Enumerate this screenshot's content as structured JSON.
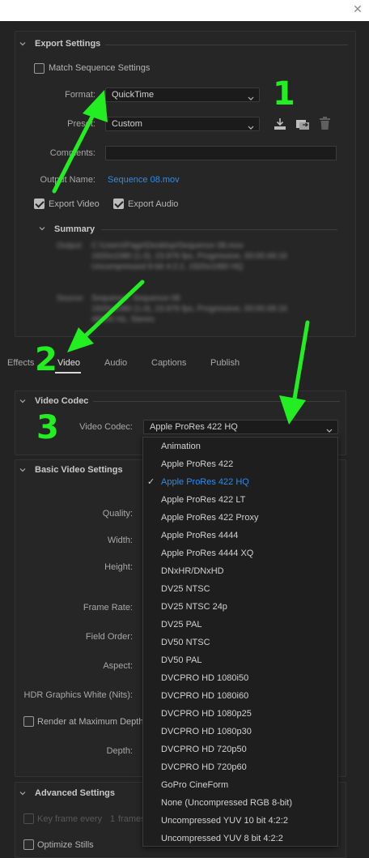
{
  "dialog": {
    "close_glyph": "✕"
  },
  "export_settings": {
    "title": "Export Settings",
    "match_sequence": {
      "label": "Match Sequence Settings",
      "checked": false
    },
    "format": {
      "label": "Format:",
      "value": "QuickTime"
    },
    "preset": {
      "label": "Preset:",
      "value": "Custom"
    },
    "comments": {
      "label": "Comments:",
      "value": ""
    },
    "output_name": {
      "label": "Output Name:",
      "value": "Sequence 08.mov"
    },
    "export_video": {
      "label": "Export Video",
      "checked": true
    },
    "export_audio": {
      "label": "Export Audio",
      "checked": true
    },
    "preset_icons": [
      "save-preset-icon",
      "import-preset-icon",
      "delete-preset-icon"
    ]
  },
  "summary": {
    "title": "Summary",
    "output_label": "Output:",
    "output_lines": [
      "C:\\Users\\Page\\Desktop\\Sequence 08.mov",
      "1920x1080 (1.0), 23.976 fps, Progressive, 00:00:49:16",
      "Uncompressed 8-bit 4:2:2, 1920x1080 HQ"
    ],
    "source_label": "Source:",
    "source_lines": [
      "Sequence, Sequence 08",
      "1920x1080 (1.0), 23.976 fps, Progressive, 00:00:49:16",
      "48000 Hz, Stereo"
    ]
  },
  "tabs": [
    {
      "label": "Effects",
      "active": false
    },
    {
      "label": "Video",
      "active": true
    },
    {
      "label": "Audio",
      "active": false
    },
    {
      "label": "Captions",
      "active": false
    },
    {
      "label": "Publish",
      "active": false
    }
  ],
  "video_codec": {
    "title": "Video Codec",
    "label": "Video Codec:",
    "value": "Apple ProRes 422 HQ",
    "options": [
      "Animation",
      "Apple ProRes 422",
      "Apple ProRes 422 HQ",
      "Apple ProRes 422 LT",
      "Apple ProRes 422 Proxy",
      "Apple ProRes 4444",
      "Apple ProRes 4444 XQ",
      "DNxHR/DNxHD",
      "DV25 NTSC",
      "DV25 NTSC 24p",
      "DV25 PAL",
      "DV50 NTSC",
      "DV50 PAL",
      "DVCPRO HD 1080i50",
      "DVCPRO HD 1080i60",
      "DVCPRO HD 1080p25",
      "DVCPRO HD 1080p30",
      "DVCPRO HD 720p50",
      "DVCPRO HD 720p60",
      "GoPro CineForm",
      "None (Uncompressed RGB 8-bit)",
      "Uncompressed YUV 10 bit 4:2:2",
      "Uncompressed YUV 8 bit 4:2:2"
    ],
    "selected_index": 2,
    "check_glyph": "✓"
  },
  "basic_video": {
    "title": "Basic Video Settings",
    "quality_label": "Quality:",
    "width_label": "Width:",
    "height_label": "Height:",
    "frame_rate_label": "Frame Rate:",
    "field_order_label": "Field Order:",
    "aspect_label": "Aspect:",
    "hdr_label": "HDR Graphics White (Nits):",
    "render_max_depth": {
      "label": "Render at Maximum Depth",
      "checked": false
    },
    "depth_label": "Depth:"
  },
  "advanced": {
    "title": "Advanced Settings",
    "key_frame": {
      "label": "Key frame every",
      "value": "1",
      "unit": "frames",
      "checked": false
    },
    "optimize_stills": {
      "label": "Optimize Stills",
      "checked": false
    }
  },
  "annotations": {
    "n1": "1",
    "n2": "2",
    "n3": "3",
    "color": "#22ee22"
  },
  "colors": {
    "accent": "#2d8ceb",
    "background": "#232323",
    "panel": "#262626"
  }
}
